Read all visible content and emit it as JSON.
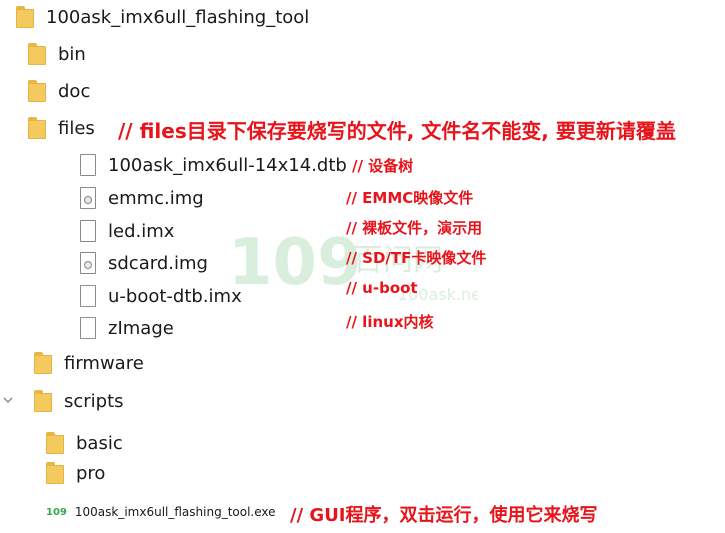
{
  "tree": {
    "root": "100ask_imx6ull_flashing_tool",
    "bin": "bin",
    "doc": "doc",
    "files": "files",
    "files_items": [
      "100ask_imx6ull-14x14.dtb",
      "emmc.img",
      "led.imx",
      "sdcard.img",
      "u-boot-dtb.imx",
      "zImage"
    ],
    "firmware": "firmware",
    "scripts": "scripts",
    "basic": "basic",
    "pro": "pro",
    "exe": "100ask_imx6ull_flashing_tool.exe",
    "exe_icon": "109"
  },
  "notes": {
    "files": "// files目录下保存要烧写的文件, 文件名不能变, 要更新请覆盖",
    "dtb": "// 设备树",
    "emmc": "// EMMC映像文件",
    "led": "// 裸板文件，演示用",
    "sdcard": "// SD/TF卡映像文件",
    "uboot": "// u-boot",
    "zimage": "// linux内核",
    "exe": "// GUI程序，双击运行，使用它来烧写"
  },
  "watermark": {
    "logo": "100ask",
    "site": "100ask.net"
  },
  "colors": {
    "annotation": "#e8141b",
    "folder": "#f4c95d",
    "watermark": "#3aa54a"
  }
}
